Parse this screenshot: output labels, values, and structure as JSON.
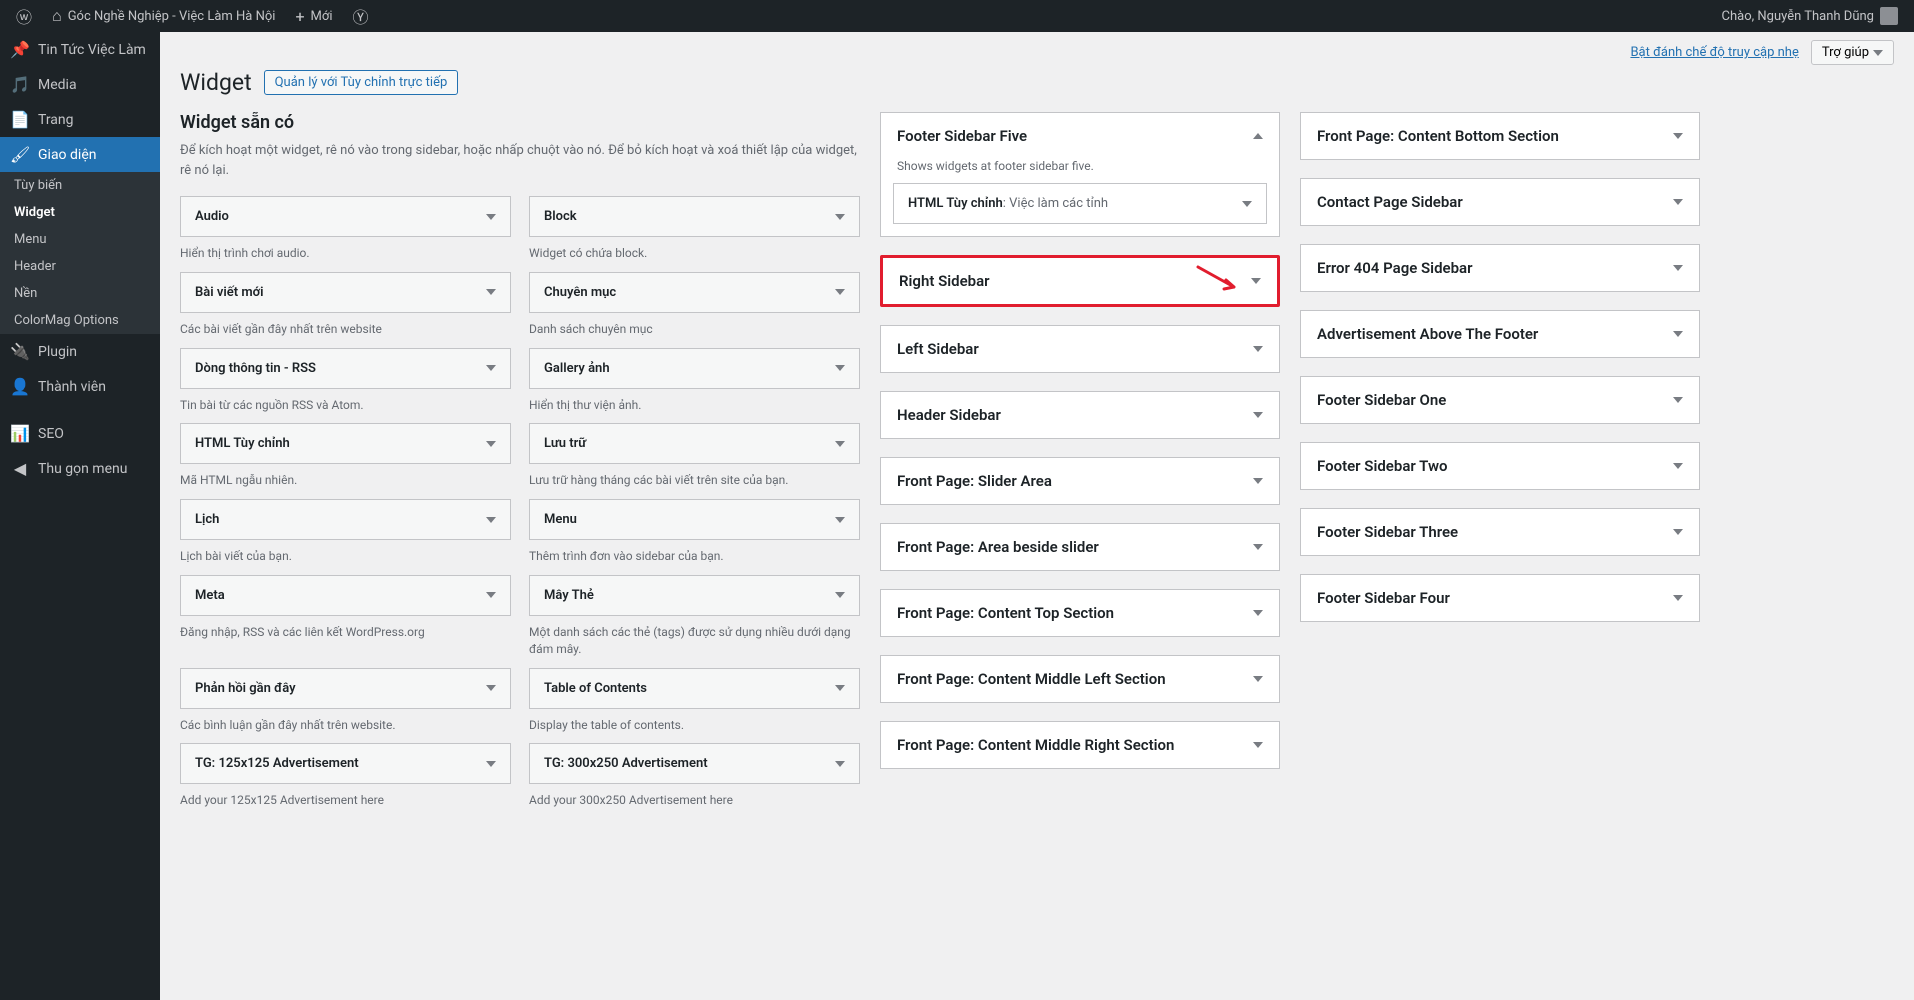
{
  "adminbar": {
    "site_name": "Góc Nghề Nghiệp - Việc Làm Hà Nội",
    "new": "Mới",
    "greeting": "Chào, Nguyễn Thanh Dũng"
  },
  "sidebar": {
    "items": [
      {
        "icon": "📌",
        "label": "Tin Tức Việc Làm"
      },
      {
        "icon": "🎵",
        "label": "Media"
      },
      {
        "icon": "📄",
        "label": "Trang"
      },
      {
        "icon": "🖌",
        "label": "Giao diện",
        "active": true
      },
      {
        "icon": "🔌",
        "label": "Plugin"
      },
      {
        "icon": "👤",
        "label": "Thành viên"
      },
      {
        "icon": "📊",
        "label": "SEO"
      },
      {
        "icon": "◀",
        "label": "Thu gọn menu"
      }
    ],
    "submenu": [
      "Tùy biến",
      "Widget",
      "Menu",
      "Header",
      "Nền",
      "ColorMag Options"
    ],
    "submenu_current": "Widget"
  },
  "top": {
    "accessibility": "Bật đánh chế độ truy cập nhẹ",
    "help": "Trợ giúp"
  },
  "heading": {
    "title": "Widget",
    "customize_btn": "Quản lý với Tùy chỉnh trực tiếp"
  },
  "available": {
    "title": "Widget sẵn có",
    "desc": "Để kích hoạt một widget, rê nó vào trong sidebar, hoặc nhấp chuột vào nó. Để bỏ kích hoạt và xoá thiết lập của widget, rê nó lại."
  },
  "widgets_left": [
    {
      "title": "Audio",
      "desc": "Hiển thị trình chơi audio."
    },
    {
      "title": "Bài viết mới",
      "desc": "Các bài viết gần đây nhất trên website"
    },
    {
      "title": "Dòng thông tin - RSS",
      "desc": "Tin bài từ các nguồn RSS và Atom."
    },
    {
      "title": "HTML Tùy chỉnh",
      "desc": "Mã HTML ngẫu nhiên."
    },
    {
      "title": "Lịch",
      "desc": "Lịch bài viết của bạn."
    },
    {
      "title": "Meta",
      "desc": "Đăng nhập, RSS và các liên kết WordPress.org"
    },
    {
      "title": "Phản hồi gần đây",
      "desc": "Các bình luận gần đây nhất trên website."
    },
    {
      "title": "TG: 125x125 Advertisement",
      "desc": "Add your 125x125 Advertisement here"
    }
  ],
  "widgets_right": [
    {
      "title": "Block",
      "desc": "Widget có chứa block."
    },
    {
      "title": "Chuyên mục",
      "desc": "Danh sách chuyên mục"
    },
    {
      "title": "Gallery ảnh",
      "desc": "Hiển thị thư viện ảnh."
    },
    {
      "title": "Lưu trữ",
      "desc": "Lưu trữ hàng tháng các bài viết trên site của bạn."
    },
    {
      "title": "Menu",
      "desc": "Thêm trình đơn vào sidebar của bạn."
    },
    {
      "title": "Mây Thẻ",
      "desc": "Một danh sách các thẻ (tags) được sử dụng nhiều dưới dạng đám mây."
    },
    {
      "title": "Table of Contents",
      "desc": "Display the table of contents."
    },
    {
      "title": "TG: 300x250 Advertisement",
      "desc": "Add your 300x250 Advertisement here"
    }
  ],
  "areas_col1": {
    "open": {
      "title": "Footer Sidebar Five",
      "desc": "Shows widgets at footer sidebar five.",
      "inner_title": "HTML Tùy chỉnh",
      "inner_sub": ": Việc làm các tỉnh"
    },
    "highlight": "Right Sidebar",
    "rest": [
      "Left Sidebar",
      "Header Sidebar",
      "Front Page: Slider Area",
      "Front Page: Area beside slider",
      "Front Page: Content Top Section",
      "Front Page: Content Middle Left Section",
      "Front Page: Content Middle Right Section"
    ]
  },
  "areas_col2": [
    "Front Page: Content Bottom Section",
    "Contact Page Sidebar",
    "Error 404 Page Sidebar",
    "Advertisement Above The Footer",
    "Footer Sidebar One",
    "Footer Sidebar Two",
    "Footer Sidebar Three",
    "Footer Sidebar Four"
  ]
}
